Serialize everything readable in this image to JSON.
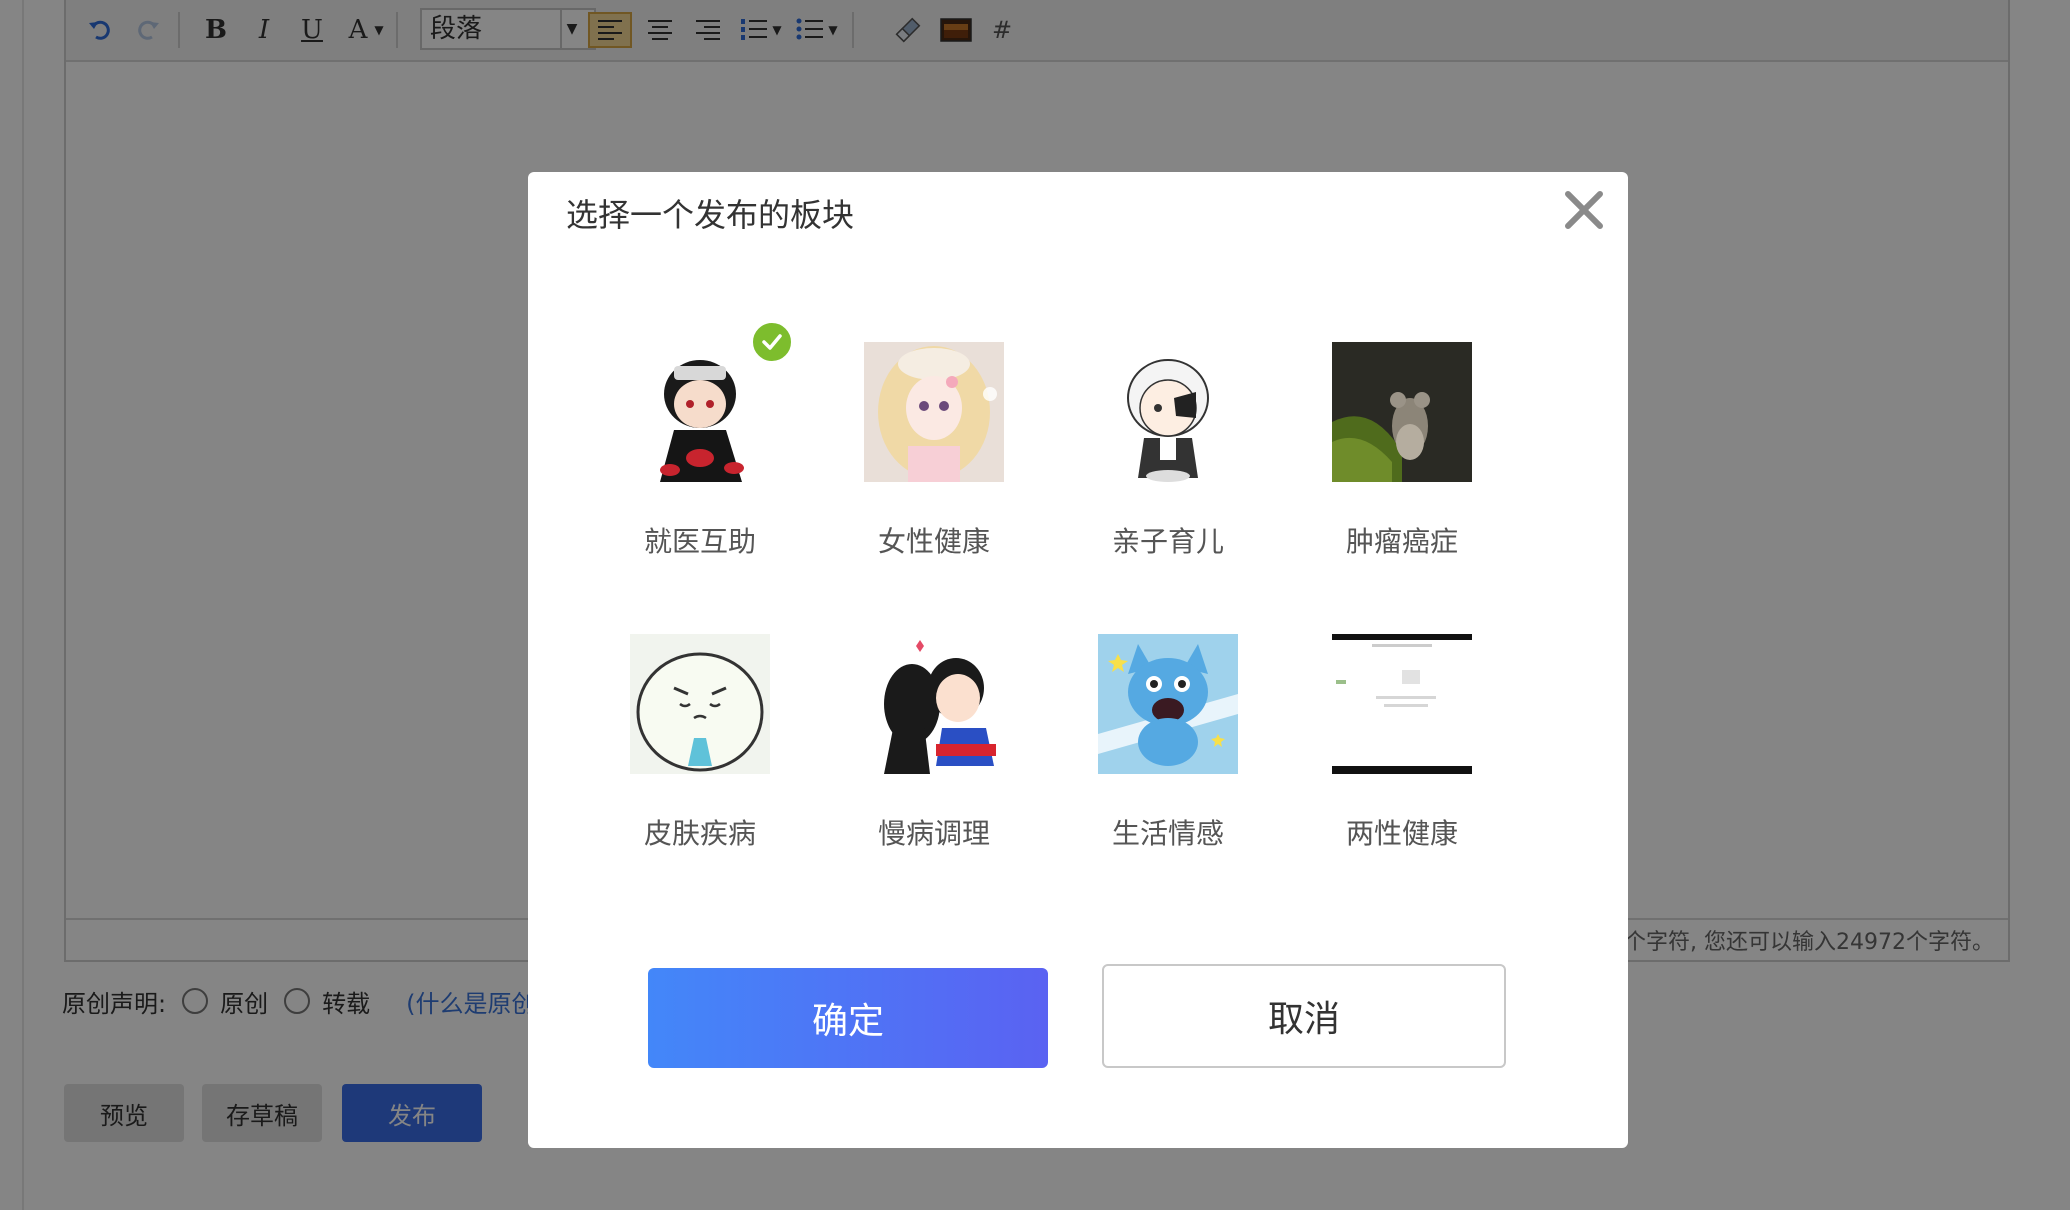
{
  "toolbar": {
    "paragraph_select": "段落",
    "hash": "#",
    "bold": "B",
    "italic": "I",
    "underline": "U",
    "font_color": "A"
  },
  "editor": {
    "char_count_text": "个字符, 您还可以输入24972个字符。"
  },
  "declaration": {
    "label": "原创声明:",
    "option_original": "原创",
    "option_repost": "转载",
    "link_text": "(什么是原创"
  },
  "actions": {
    "preview": "预览",
    "save_draft": "存草稿",
    "publish": "发布"
  },
  "dialog": {
    "title": "选择一个发布的板块",
    "boards": [
      {
        "label": "就医互助",
        "selected": true
      },
      {
        "label": "女性健康",
        "selected": false
      },
      {
        "label": "亲子育儿",
        "selected": false
      },
      {
        "label": "肿瘤癌症",
        "selected": false
      },
      {
        "label": "皮肤疾病",
        "selected": false
      },
      {
        "label": "慢病调理",
        "selected": false
      },
      {
        "label": "生活情感",
        "selected": false
      },
      {
        "label": "两性健康",
        "selected": false
      }
    ],
    "confirm": "确定",
    "cancel": "取消"
  },
  "colors": {
    "accent_start": "#4387f9",
    "accent_end": "#5a62f2",
    "check_green": "#7dbd2d",
    "publish_blue": "#3a6ee8"
  }
}
